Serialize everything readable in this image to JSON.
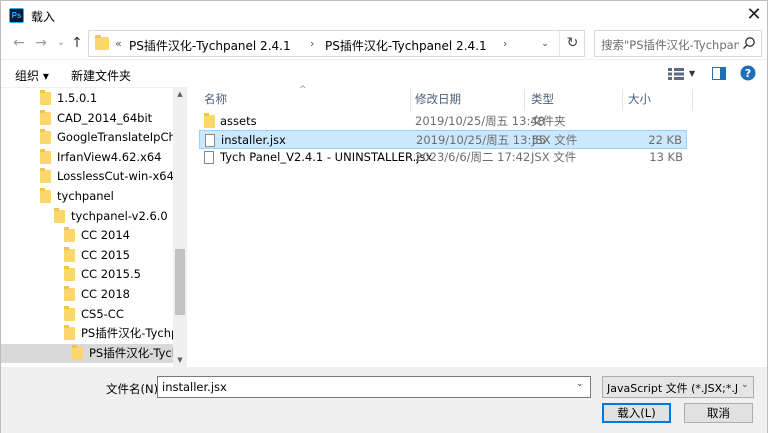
{
  "title": "载入",
  "app_icon_text": "Ps",
  "colors": {
    "accent": "#0078d7",
    "folder": "#fcd76b",
    "selection": "#cce8ff"
  },
  "nav": {
    "back": "←",
    "forward": "→",
    "recent": "⌄",
    "up": "↑",
    "address_prefix": "«",
    "segments": [
      "PS插件汉化-Tychpanel 2.4.1",
      "PS插件汉化-Tychpanel 2.4.1"
    ],
    "separator": "›",
    "refresh": "↻",
    "search_placeholder": "搜索\"PS插件汉化-Tychpanel..."
  },
  "toolbar": {
    "organize": "组织 ▾",
    "new_folder": "新建文件夹"
  },
  "tree": [
    {
      "label": "1.5.0.1",
      "indent": 0
    },
    {
      "label": "CAD_2014_64bit",
      "indent": 0
    },
    {
      "label": "GoogleTranslateIpCheck",
      "indent": 0
    },
    {
      "label": "IrfanView4.62.x64",
      "indent": 0
    },
    {
      "label": "LosslessCut-win-x64",
      "indent": 0
    },
    {
      "label": "tychpanel",
      "indent": 0
    },
    {
      "label": "tychpanel-v2.6.0",
      "indent": 1
    },
    {
      "label": "CC 2014",
      "indent": 2
    },
    {
      "label": "CC 2015",
      "indent": 2
    },
    {
      "label": "CC 2015.5",
      "indent": 2
    },
    {
      "label": "CC 2018",
      "indent": 2
    },
    {
      "label": "CS5-CC",
      "indent": 2
    },
    {
      "label": "PS插件汉化-Tychpanel",
      "indent": 2
    },
    {
      "label": "PS插件汉化-Tychpanel",
      "indent": 3,
      "selected": true
    }
  ],
  "columns": {
    "name": "名称",
    "modified": "修改日期",
    "type": "类型",
    "size": "大小"
  },
  "files": [
    {
      "name": "assets",
      "modified": "2019/10/25/周五 13:48",
      "type": "文件夹",
      "size": "",
      "kind": "folder"
    },
    {
      "name": "installer.jsx",
      "modified": "2019/10/25/周五 13:55",
      "type": "JSX 文件",
      "size": "22 KB",
      "kind": "file",
      "selected": true
    },
    {
      "name": "Tych Panel_V2.4.1 - UNINSTALLER.jsx",
      "modified": "2023/6/6/周二 17:42",
      "type": "JSX 文件",
      "size": "13 KB",
      "kind": "file"
    }
  ],
  "bottom": {
    "filename_label": "文件名(N):",
    "filename_value": "installer.jsx",
    "filetype_value": "JavaScript 文件 (*.JSX;*.JS;*.JS",
    "open_label": "载入(L)",
    "cancel_label": "取消"
  }
}
